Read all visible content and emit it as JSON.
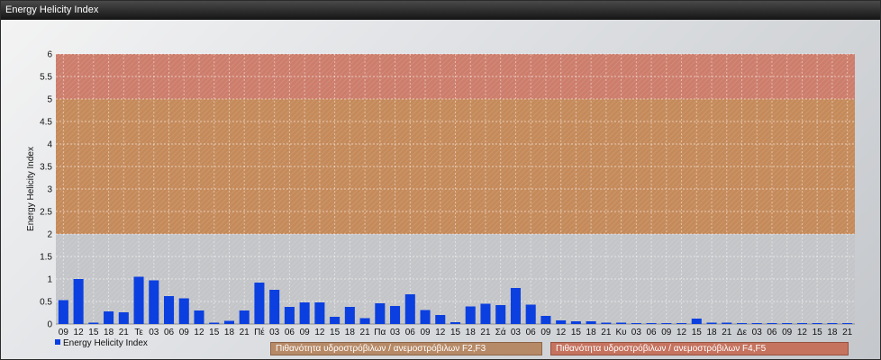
{
  "window": {
    "title": "Energy Helicity Index"
  },
  "chart_data": {
    "type": "bar",
    "title": "Energy Helicity Index",
    "xlabel": "",
    "ylabel": "Energy Helicity Index",
    "ylim": [
      0,
      6
    ],
    "yticks": [
      "0",
      "0.5",
      "1",
      "1.5",
      "2",
      "2.5",
      "3",
      "3.5",
      "4",
      "4.5",
      "5",
      "5.5",
      "6"
    ],
    "grid": true,
    "legend_position": "bottom",
    "colors": {
      "bar": "#0b3fe0",
      "band_f2f3": "#c57a3b",
      "band_f4f5": "#cf6a54"
    },
    "bands": [
      {
        "name": "Πιθανότητα υδροστρόβιλων / ανεμοστρόβιλων F2,F3",
        "from": 2,
        "to": 5
      },
      {
        "name": "Πιθανότητα υδροστρόβιλων / ανεμοστρόβιλων F4,F5",
        "from": 5,
        "to": 6
      }
    ],
    "categories": [
      "09",
      "12",
      "15",
      "18",
      "21",
      "Τε",
      "03",
      "06",
      "09",
      "12",
      "15",
      "18",
      "21",
      "Πέ",
      "03",
      "06",
      "09",
      "12",
      "15",
      "18",
      "21",
      "Πα",
      "03",
      "06",
      "09",
      "12",
      "15",
      "18",
      "21",
      "Σά",
      "03",
      "06",
      "09",
      "12",
      "15",
      "18",
      "21",
      "Κυ",
      "03",
      "06",
      "09",
      "12",
      "15",
      "18",
      "21",
      "Δε",
      "03",
      "06",
      "09",
      "12",
      "15",
      "18",
      "21"
    ],
    "series": [
      {
        "name": "Energy Helicity Index",
        "values": [
          0.53,
          1.0,
          0.03,
          0.28,
          0.26,
          1.05,
          0.97,
          0.62,
          0.57,
          0.3,
          0.03,
          0.07,
          0.3,
          0.92,
          0.76,
          0.38,
          0.48,
          0.48,
          0.16,
          0.38,
          0.13,
          0.46,
          0.4,
          0.66,
          0.31,
          0.2,
          0.04,
          0.39,
          0.45,
          0.42,
          0.8,
          0.43,
          0.18,
          0.08,
          0.06,
          0.06,
          0.03,
          0.03,
          0.02,
          0.02,
          0.02,
          0.02,
          0.12,
          0.03,
          0.03,
          0.02,
          0.02,
          0.02,
          0.02,
          0.02,
          0.02,
          0.02,
          0.02
        ]
      }
    ]
  }
}
